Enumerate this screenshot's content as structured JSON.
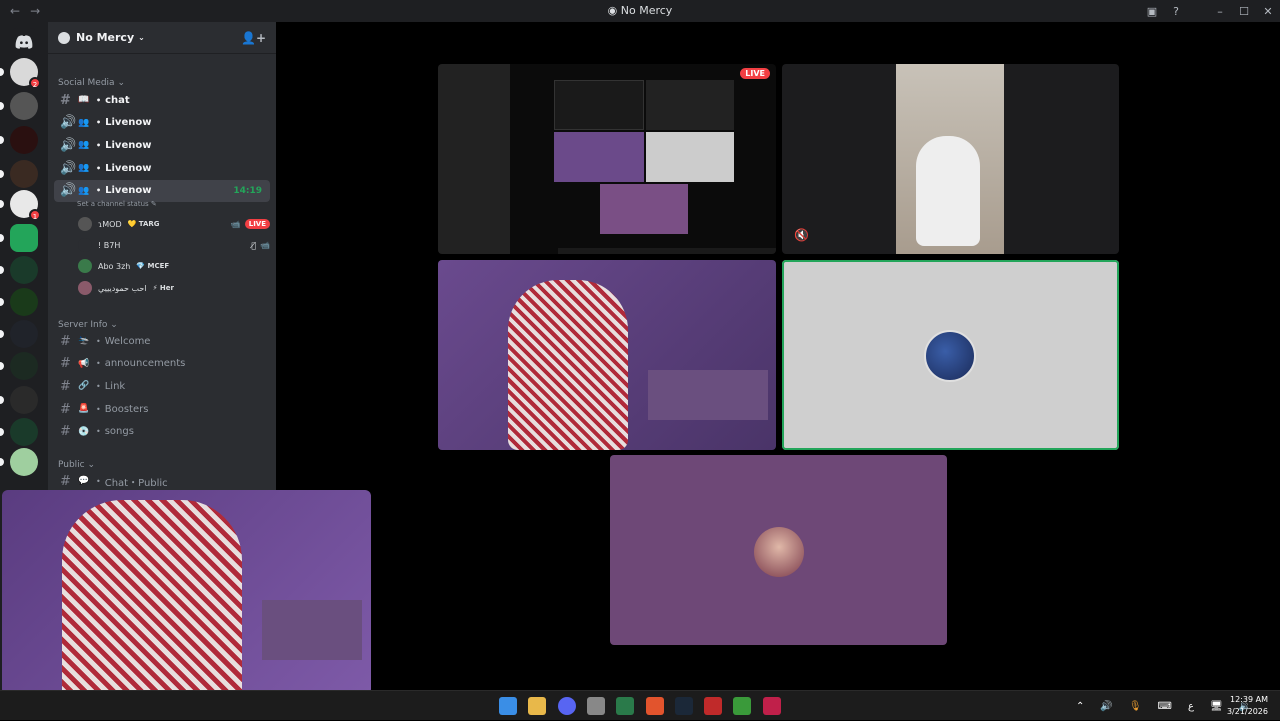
{
  "titlebar": {
    "title": "No Mercy",
    "back": "←",
    "forward": "→",
    "minimize": "–",
    "maximize": "☐",
    "close": "✕"
  },
  "guilds": [
    {
      "name": "guild-1",
      "color": "#d9d9d9",
      "badge": "2"
    },
    {
      "name": "guild-2",
      "color": "#555555"
    },
    {
      "name": "guild-3",
      "color": "#2a1010"
    },
    {
      "name": "guild-4",
      "color": "#3a2a22"
    },
    {
      "name": "guild-5",
      "color": "#e8e8e8",
      "badge": "1"
    },
    {
      "name": "guild-6",
      "color": "#23a55a"
    },
    {
      "name": "guild-7",
      "color": "#1a3a2a"
    },
    {
      "name": "guild-8",
      "color": "#1a3a1a"
    },
    {
      "name": "guild-9",
      "color": "#20232a"
    },
    {
      "name": "guild-10",
      "color": "#1c2a22"
    },
    {
      "name": "guild-11",
      "color": "#2a2a2a"
    },
    {
      "name": "guild-12",
      "color": "#1a3a2a"
    },
    {
      "name": "guild-13",
      "color": "#9fcf9f"
    }
  ],
  "server": {
    "name": "No Mercy",
    "chevron": "⌄"
  },
  "categories": {
    "social": "Social Media",
    "server_info": "Server Info",
    "public": "Public"
  },
  "social_channels": [
    {
      "label": "chat",
      "icon": "📖"
    },
    {
      "label": "Livenow",
      "icon": "👥"
    },
    {
      "label": "Livenow",
      "icon": "👥"
    },
    {
      "label": "Livenow",
      "icon": "👥"
    },
    {
      "label": "Livenow",
      "icon": "👥",
      "time": "14:19"
    }
  ],
  "status_line": "Set a channel status ✎",
  "members": [
    {
      "name": "ɿMOD",
      "tag": "💛 TARG",
      "live": "LIVE"
    },
    {
      "name": "! B7H"
    },
    {
      "name": "Abo 3zh",
      "tag": "💎 MCEF"
    },
    {
      "name": "احب حموديييي",
      "tag": "⚡ Her"
    }
  ],
  "info_channels": [
    {
      "label": "Welcome",
      "icon": "🛬"
    },
    {
      "label": "announcements",
      "icon": "📢"
    },
    {
      "label": "Link",
      "icon": "🔗"
    },
    {
      "label": "Boosters",
      "icon": "🚨"
    },
    {
      "label": "songs",
      "icon": "💿"
    }
  ],
  "public_channels": [
    {
      "label": "Chat・Public",
      "icon": "💬"
    }
  ],
  "stage": {
    "live_label": "LIVE",
    "muted_icon": "🔇"
  },
  "taskbar": {
    "time": "12:39 AM",
    "date": "3/21/2026",
    "lang": "ع",
    "apps": [
      "windows",
      "files",
      "discord",
      "chrome-alt",
      "xbox",
      "brave",
      "steam",
      "app-red",
      "minecraft",
      "app-a"
    ]
  }
}
